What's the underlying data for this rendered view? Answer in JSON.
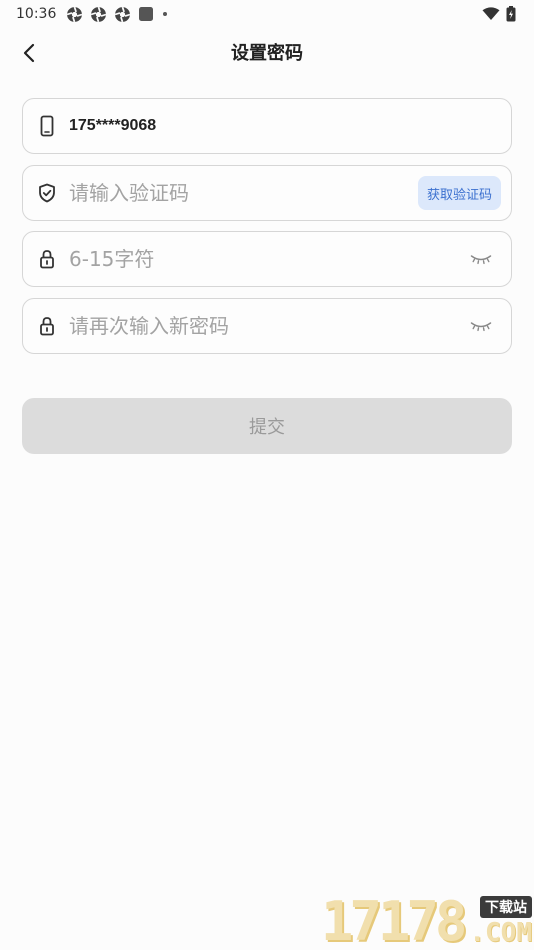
{
  "status_bar": {
    "time": "10:36",
    "notification_icons": [
      "settings-aperture-icon",
      "settings-aperture-icon",
      "settings-aperture-icon",
      "square-app-icon",
      "dot-icon"
    ],
    "right_icons": [
      "wifi-icon",
      "battery-charging-icon"
    ]
  },
  "header": {
    "title": "设置密码",
    "back_icon": "chevron-left-icon"
  },
  "form": {
    "phone": {
      "icon": "phone-icon",
      "value": "175****9068"
    },
    "code": {
      "icon": "shield-check-icon",
      "placeholder": "请输入验证码",
      "button_label": "获取验证码"
    },
    "password": {
      "icon": "lock-icon",
      "placeholder": "6-15字符",
      "toggle_icon": "eye-closed-icon"
    },
    "confirm_password": {
      "icon": "lock-icon",
      "placeholder": "请再次输入新密码",
      "toggle_icon": "eye-closed-icon"
    },
    "submit_label": "提交"
  },
  "colors": {
    "accent": "#3b70cf",
    "accent_bg": "#dce8fb",
    "disabled_button": "#dcdcdc"
  },
  "watermark": {
    "number": "17178",
    "badge": "下载站",
    "domain": ".COM"
  }
}
